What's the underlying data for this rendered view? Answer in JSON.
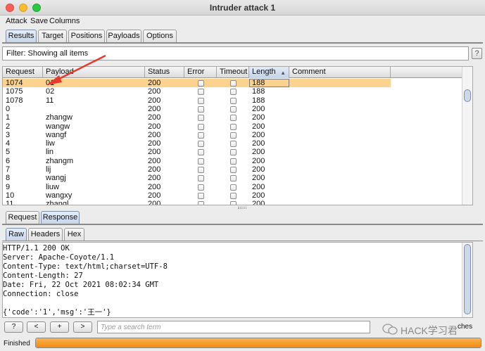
{
  "window": {
    "title": "Intruder attack 1"
  },
  "menu": [
    "Attack",
    "Save",
    "Columns"
  ],
  "main_tabs": [
    "Results",
    "Target",
    "Positions",
    "Payloads",
    "Options"
  ],
  "filter": {
    "text": "Filter: Showing all items",
    "help": "?"
  },
  "table": {
    "columns": [
      "Request",
      "Payload",
      "Status",
      "Error",
      "Timeout",
      "Length",
      "Comment"
    ],
    "sorted_column": "Length",
    "rows": [
      {
        "request": "1074",
        "payload": "01",
        "status": "200",
        "length": "188",
        "selected": true
      },
      {
        "request": "1075",
        "payload": "02",
        "status": "200",
        "length": "188",
        "selected": false
      },
      {
        "request": "1078",
        "payload": "11",
        "status": "200",
        "length": "188",
        "selected": false
      },
      {
        "request": "0",
        "payload": "",
        "status": "200",
        "length": "200",
        "selected": false
      },
      {
        "request": "1",
        "payload": "zhangw",
        "status": "200",
        "length": "200",
        "selected": false
      },
      {
        "request": "2",
        "payload": "wangw",
        "status": "200",
        "length": "200",
        "selected": false
      },
      {
        "request": "3",
        "payload": "wangf",
        "status": "200",
        "length": "200",
        "selected": false
      },
      {
        "request": "4",
        "payload": "liw",
        "status": "200",
        "length": "200",
        "selected": false
      },
      {
        "request": "5",
        "payload": "lin",
        "status": "200",
        "length": "200",
        "selected": false
      },
      {
        "request": "6",
        "payload": "zhangm",
        "status": "200",
        "length": "200",
        "selected": false
      },
      {
        "request": "7",
        "payload": "lij",
        "status": "200",
        "length": "200",
        "selected": false
      },
      {
        "request": "8",
        "payload": "wangj",
        "status": "200",
        "length": "200",
        "selected": false
      },
      {
        "request": "9",
        "payload": "liuw",
        "status": "200",
        "length": "200",
        "selected": false
      },
      {
        "request": "10",
        "payload": "wangxy",
        "status": "200",
        "length": "200",
        "selected": false
      },
      {
        "request": "11",
        "payload": "zhangl",
        "status": "200",
        "length": "200",
        "selected": false
      }
    ]
  },
  "detail_tabs": [
    "Request",
    "Response"
  ],
  "view_tabs": [
    "Raw",
    "Headers",
    "Hex"
  ],
  "response": {
    "lines": [
      "HTTP/1.1 200 OK",
      "Server: Apache-Coyote/1.1",
      "Content-Type: text/html;charset=UTF-8",
      "Content-Length: 27",
      "Date: Fri, 22 Oct 2021 08:02:34 GMT",
      "Connection: close",
      "",
      "{'code':'1','msg':'王一'}"
    ]
  },
  "search": {
    "placeholder": "Type a search term",
    "buttons": [
      "?",
      "<",
      "+",
      ">"
    ],
    "matches_label": "ches"
  },
  "watermark": "HACK学习君",
  "status": {
    "label": "Finished",
    "progress": 1.0
  },
  "colors": {
    "selected_row": "#fbd38f",
    "progress": "#f5a030",
    "arrow": "#e53a2d"
  }
}
